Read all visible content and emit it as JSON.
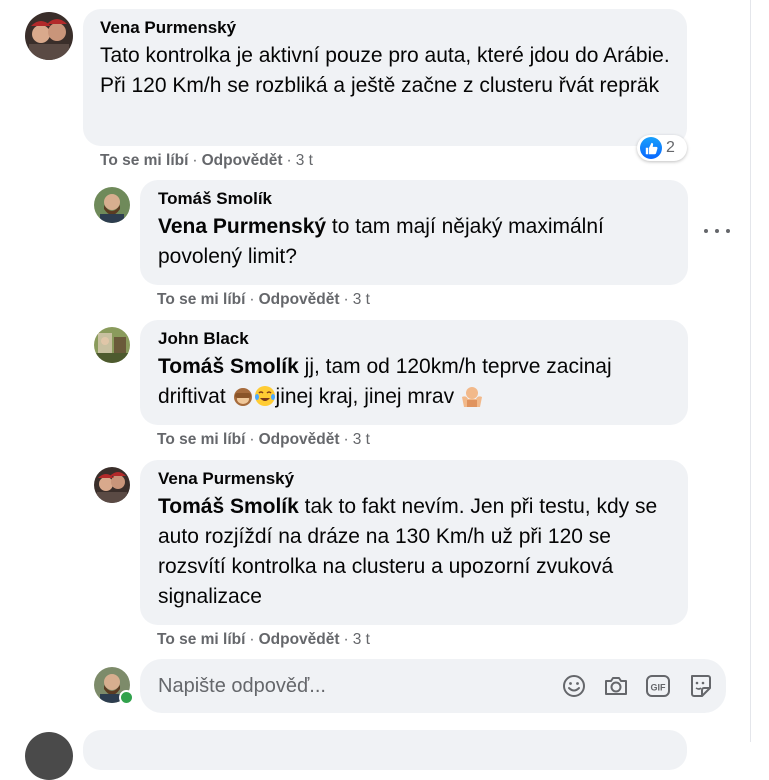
{
  "comments": [
    {
      "author": "Vena Purmenský",
      "mention": "",
      "text": "Tato kontrolka je aktivní pouze pro auta, které jdou do Arábie. Při 120 Km/h se rozbliká a ještě začne z clusteru řvát repräk",
      "like_label": "To se mi líbí",
      "reply_label": "Odpovědět",
      "time": "3 t",
      "reaction_count": "2"
    },
    {
      "author": "Tomáš Smolík",
      "mention": "Vena Purmenský",
      "text": " to tam mají nějaký maximální povolený limit?",
      "like_label": "To se mi líbí",
      "reply_label": "Odpovědět",
      "time": "3 t"
    },
    {
      "author": "John Black",
      "mention": "Tomáš Smolík",
      "text_a": " jj, tam od 120km/h teprve zacinaj driftivat ",
      "text_b": "jinej kraj, jinej mrav ",
      "like_label": "To se mi líbí",
      "reply_label": "Odpovědět",
      "time": "3 t"
    },
    {
      "author": "Vena Purmenský",
      "mention": "Tomáš Smolík",
      "text": " tak to fakt nevím. Jen při testu, kdy se auto rozjíždí na dráze na 130 Km/h už při 120 se rozsvítí kontrolka na clusteru a upozorní zvuková signalizace",
      "like_label": "To se mi líbí",
      "reply_label": "Odpovědět",
      "time": "3 t"
    }
  ],
  "composer": {
    "placeholder": "Napište odpověď..."
  },
  "icons": [
    "like-icon",
    "more-options-icon",
    "emoji-icon",
    "camera-icon",
    "gif-icon",
    "sticker-icon",
    "see-no-evil-monkey-emoji",
    "tears-of-joy-emoji",
    "shrug-emoji"
  ],
  "colors": {
    "bubble": "#f0f2f5",
    "meta_text": "#65676b",
    "like_blue": "#0866ff",
    "online_green": "#31a24c"
  }
}
